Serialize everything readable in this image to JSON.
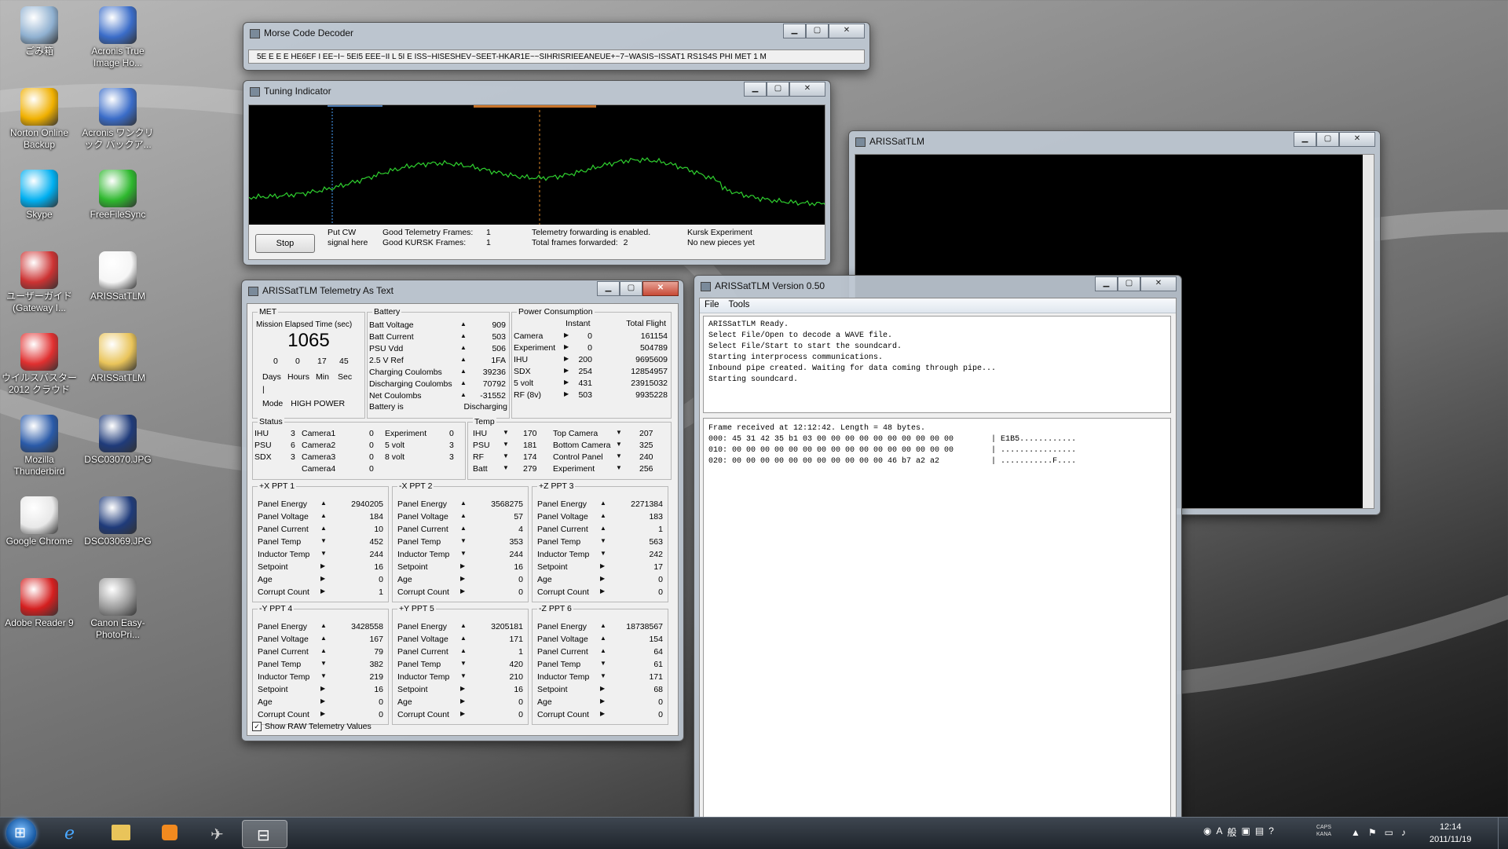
{
  "desktop": {
    "icons": [
      {
        "label": "ごみ箱",
        "icon": "recycle-bin-icon"
      },
      {
        "label": "Acronis True Image Ho...",
        "icon": "acronis-icon"
      },
      {
        "label": "Norton Online Backup",
        "icon": "norton-icon"
      },
      {
        "label": "Acronis ワンクリック バックア...",
        "icon": "acronis-backup-icon"
      },
      {
        "label": "Skype",
        "icon": "skype-icon"
      },
      {
        "label": "FreeFileSync",
        "icon": "freefilesync-icon"
      },
      {
        "label": "ユーザーガイド (Gateway I...",
        "icon": "help-icon"
      },
      {
        "label": "ARISSatTLM",
        "icon": "satellite-icon"
      },
      {
        "label": "ウイルスバスター 2012 クラウド",
        "icon": "virusbuster-icon"
      },
      {
        "label": "ARISSatTLM",
        "icon": "folder-icon"
      },
      {
        "label": "Mozilla Thunderbird",
        "icon": "thunderbird-icon"
      },
      {
        "label": "DSC03070.JPG",
        "icon": "image-icon"
      },
      {
        "label": "Google Chrome",
        "icon": "chrome-icon"
      },
      {
        "label": "DSC03069.JPG",
        "icon": "image-icon"
      },
      {
        "label": "Adobe Reader 9",
        "icon": "adobe-reader-icon"
      },
      {
        "label": "Canon Easy-PhotoPri...",
        "icon": "canon-icon"
      }
    ]
  },
  "morse": {
    "title": "Morse Code Decoder",
    "text": "5E E  E E HE6EF I EE~I~ 5EI5 EEE~II L 5I E ISS~HISESHEV~SEET-HKAR1E~~SIHRISRIEEANEUE+~7~WASIS~ISSAT1 RS1S4S PHI MET 1 M"
  },
  "tuning": {
    "title": "Tuning Indicator",
    "stop": "Stop",
    "put_cw": "Put CW",
    "signal_here": "signal here",
    "good_tlm_label": "Good Telemetry Frames:",
    "good_tlm_val": "1",
    "good_kursk_label": "Good KURSK Frames:",
    "good_kursk_val": "1",
    "fwd_enabled": "Telemetry forwarding is enabled.",
    "total_fwd_label": "Total frames forwarded:",
    "total_fwd_val": "2",
    "kursk": "Kursk Experiment",
    "no_new": "No new pieces yet"
  },
  "tlm_window": {
    "title": "ARISSatTLM",
    "version_title": "ARISSatTLM Version 0.50",
    "menu": [
      "File",
      "Tools"
    ],
    "log": [
      "ARISSatTLM Ready.",
      "Select File/Open to decode a WAVE file.",
      "Select File/Start to start the soundcard.",
      "Starting interprocess communications.",
      "Inbound pipe created. Waiting for data coming through pipe...",
      "Starting soundcard."
    ],
    "frame": [
      "Frame received at 12:12:42. Length = 48 bytes.",
      "000: 45 31 42 35 b1 03 00 00 00 00 00 00 00 00 00 00        | E1B5............",
      "010: 00 00 00 00 00 00 00 00 00 00 00 00 00 00 00 00        | ................",
      "020: 00 00 00 00 00 00 00 00 00 00 00 46 b7 a2 a2           | ...........F...."
    ]
  },
  "text_window": {
    "title": "ARISSatTLM Telemetry As Text",
    "met": {
      "title": "MET",
      "elapsed_label": "Mission Elapsed Time (sec)",
      "elapsed": "1065",
      "days": "0",
      "hours": "0",
      "min": "17",
      "sec": "45",
      "days_l": "Days",
      "hours_l": "Hours",
      "min_l": "Min",
      "sec_l": "Sec",
      "bar": "|",
      "mode_label": "Mode",
      "mode": "HIGH POWER"
    },
    "battery": {
      "title": "Battery",
      "rows": [
        {
          "label": "Batt Voltage",
          "value": "909"
        },
        {
          "label": "Batt Current",
          "value": "503"
        },
        {
          "label": "PSU Vdd",
          "value": "506"
        },
        {
          "label": "2.5 V Ref",
          "value": "1FA"
        },
        {
          "label": "Charging Coulombs",
          "value": "39236"
        },
        {
          "label": "Discharging Coulombs",
          "value": "70792"
        },
        {
          "label": "Net Coulombs",
          "value": "-31552"
        }
      ],
      "is_label": "Battery is",
      "is_value": "Discharging"
    },
    "power": {
      "title": "Power Consumption",
      "instant": "Instant",
      "total": "Total Flight",
      "rows": [
        {
          "label": "Camera",
          "instant": "0",
          "total": "161154"
        },
        {
          "label": "Experiment",
          "instant": "0",
          "total": "504789"
        },
        {
          "label": "IHU",
          "instant": "200",
          "total": "9695609"
        },
        {
          "label": "SDX",
          "instant": "254",
          "total": "12854957"
        },
        {
          "label": "5 volt",
          "instant": "431",
          "total": "23915032"
        },
        {
          "label": "RF (8v)",
          "instant": "503",
          "total": "9935228"
        }
      ]
    },
    "status": {
      "title": "Status",
      "col1": [
        {
          "label": "IHU",
          "value": "3"
        },
        {
          "label": "PSU",
          "value": "6"
        },
        {
          "label": "SDX",
          "value": "3"
        }
      ],
      "col2": [
        {
          "label": "Camera1",
          "value": "0"
        },
        {
          "label": "Camera2",
          "value": "0"
        },
        {
          "label": "Camera3",
          "value": "0"
        },
        {
          "label": "Camera4",
          "value": "0"
        }
      ],
      "col3": [
        {
          "label": "Experiment",
          "value": "0"
        },
        {
          "label": "5 volt",
          "value": "3"
        },
        {
          "label": "8 volt",
          "value": "3"
        }
      ]
    },
    "temp": {
      "title": "Temp",
      "col1": [
        {
          "label": "IHU",
          "value": "170"
        },
        {
          "label": "PSU",
          "value": "181"
        },
        {
          "label": "RF",
          "value": "174"
        },
        {
          "label": "Batt",
          "value": "279"
        }
      ],
      "col2": [
        {
          "label": "Top Camera",
          "value": "207"
        },
        {
          "label": "Bottom Camera",
          "value": "325"
        },
        {
          "label": "Control Panel",
          "value": "240"
        },
        {
          "label": "Experiment",
          "value": "256"
        }
      ]
    },
    "ppt_labels": [
      "Panel Energy",
      "Panel Voltage",
      "Panel Current",
      "Panel Temp",
      "Inductor Temp",
      "Setpoint",
      "Age",
      "Corrupt Count"
    ],
    "ppts": [
      {
        "title": "+X PPT 1",
        "values": [
          "2940205",
          "184",
          "10",
          "452",
          "244",
          "16",
          "0",
          "1"
        ]
      },
      {
        "title": "-X PPT 2",
        "values": [
          "3568275",
          "57",
          "4",
          "353",
          "244",
          "16",
          "0",
          "0"
        ]
      },
      {
        "title": "+Z PPT 3",
        "values": [
          "2271384",
          "183",
          "1",
          "563",
          "242",
          "17",
          "0",
          "0"
        ]
      },
      {
        "title": "-Y PPT 4",
        "values": [
          "3428558",
          "167",
          "79",
          "382",
          "219",
          "16",
          "0",
          "0"
        ]
      },
      {
        "title": "+Y PPT 5",
        "values": [
          "3205181",
          "171",
          "1",
          "420",
          "210",
          "16",
          "0",
          "0"
        ]
      },
      {
        "title": "-Z PPT 6",
        "values": [
          "18738567",
          "154",
          "64",
          "61",
          "171",
          "68",
          "0",
          "0"
        ]
      }
    ],
    "show_raw": "Show RAW Telemetry Values"
  },
  "taskbar": {
    "time": "12:14",
    "date": "2011/11/19",
    "caps": "CAPS",
    "kana": "KANA"
  }
}
